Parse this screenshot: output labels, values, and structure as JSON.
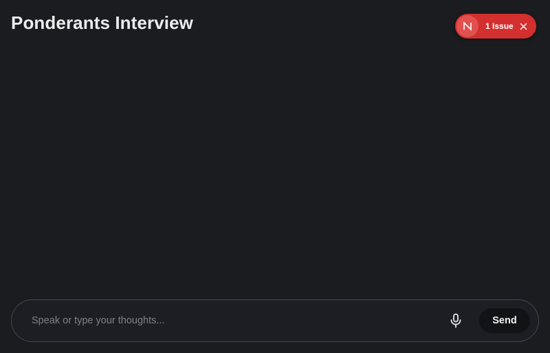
{
  "header": {
    "title": "Ponderants Interview"
  },
  "issue_indicator": {
    "badge_letter": "N",
    "label": "1 Issue",
    "color": "#d32f2f"
  },
  "composer": {
    "placeholder": "Speak or type your thoughts...",
    "value": "",
    "mic_icon": "microphone-icon",
    "send_label": "Send"
  },
  "theme": {
    "background": "#1b1c20",
    "accent": "#d32f2f"
  }
}
